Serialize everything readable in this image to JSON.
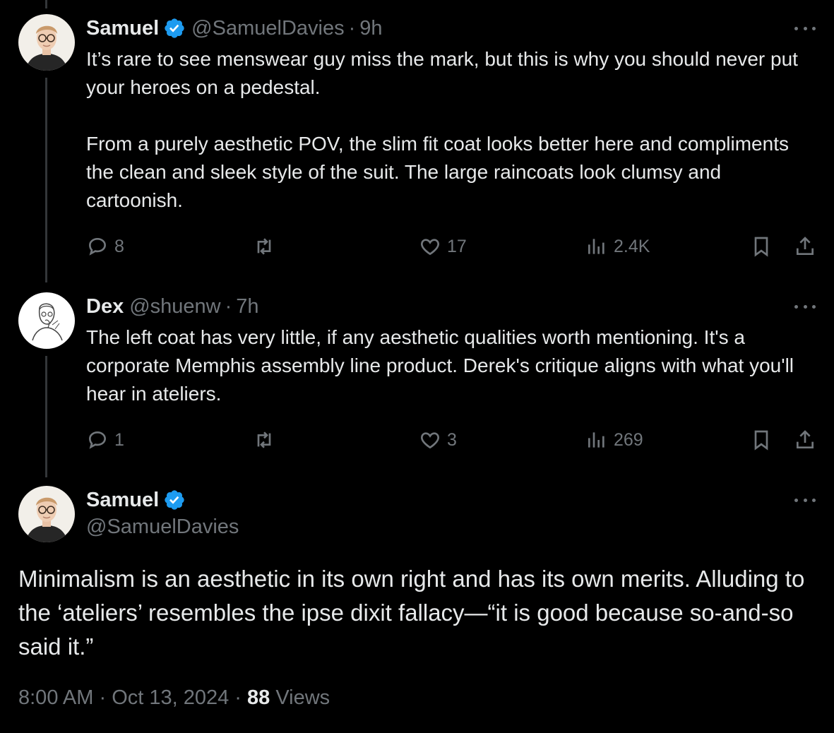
{
  "tweets": [
    {
      "name": "Samuel",
      "verified": true,
      "handle": "@SamuelDavies",
      "separator": "·",
      "time": "9h",
      "text": "It’s rare to see menswear guy miss the mark, but this is why you should never put your heroes on a pedestal.\n\nFrom a purely aesthetic POV, the slim fit coat looks better here and compliments the clean and sleek style of the suit. The large raincoats look clumsy and cartoonish.",
      "replies": "8",
      "likes": "17",
      "views": "2.4K"
    },
    {
      "name": "Dex",
      "verified": false,
      "handle": "@shuenw",
      "separator": "·",
      "time": "7h",
      "text": "The left coat has very little, if any aesthetic qualities worth mentioning. It's a corporate Memphis assembly line product. Derek's critique aligns with what you'll hear in ateliers.",
      "replies": "1",
      "likes": "3",
      "views": "269"
    }
  ],
  "main_tweet": {
    "name": "Samuel",
    "verified": true,
    "handle": "@SamuelDavies",
    "text": "Minimalism is an aesthetic in its own right and has its own merits. Alluding to the ‘ateliers’ resembles the ipse dixit fallacy—“it is good because so-and-so said it.”",
    "time": "8:00 AM",
    "date": "Oct 13, 2024",
    "separator": " · ",
    "views_count": "88",
    "views_label": " Views"
  },
  "icons": {
    "reply": "reply-icon",
    "repost": "repost-icon",
    "like": "heart-icon",
    "views": "views-icon",
    "bookmark": "bookmark-icon",
    "share": "share-icon",
    "more": "more-icon",
    "verified": "verified-badge-icon"
  },
  "colors": {
    "background": "#000000",
    "text": "#e7e9ea",
    "muted": "#71767b",
    "verified": "#1d9bf0",
    "thread_line": "#333639"
  }
}
